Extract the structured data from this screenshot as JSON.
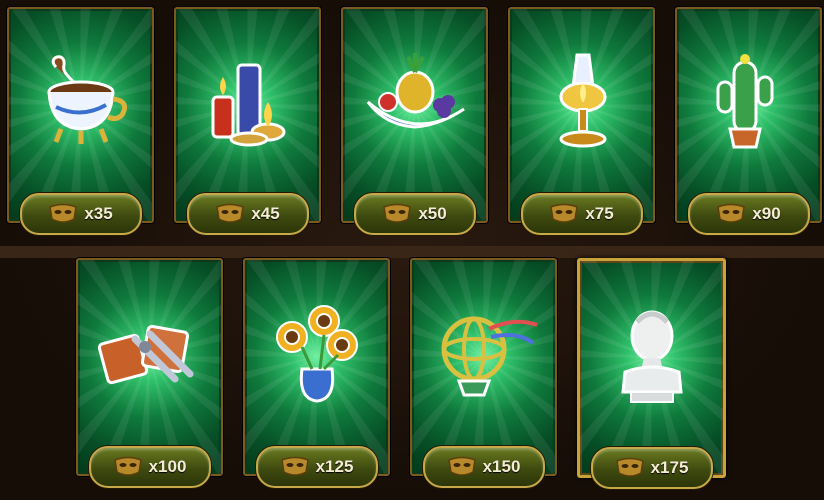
{
  "items": [
    {
      "name": "teacup",
      "price": "x35"
    },
    {
      "name": "candles",
      "price": "x45"
    },
    {
      "name": "fruit-bowl",
      "price": "x50"
    },
    {
      "name": "oil-lamp",
      "price": "x75"
    },
    {
      "name": "cactus",
      "price": "x90"
    },
    {
      "name": "scrolls-and-pliers",
      "price": "x100"
    },
    {
      "name": "sunflowers",
      "price": "x125"
    },
    {
      "name": "armillary-sphere",
      "price": "x150"
    },
    {
      "name": "marble-bust",
      "price": "x175"
    }
  ],
  "colors": {
    "card_green": "#0f7a3c",
    "glow": "#6ff0a0",
    "price_pill": "#4a5814",
    "price_border": "#c7a94a",
    "frame_gold": "#c9a23a"
  },
  "currency_icon": "mask-icon"
}
